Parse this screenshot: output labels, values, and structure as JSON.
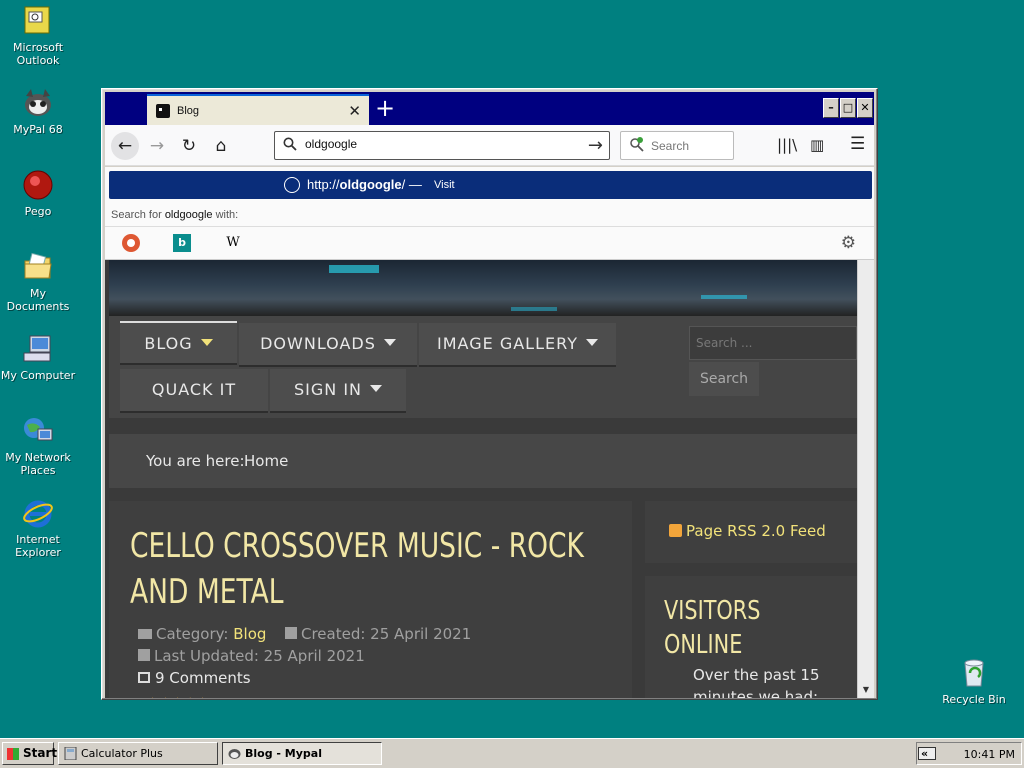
{
  "desktop": {
    "icons": [
      {
        "label_line1": "Microsoft",
        "label_line2": "Outlook",
        "icon": "outlook-icon"
      },
      {
        "label_line1": "MyPal 68",
        "label_line2": "",
        "icon": "mypal-icon"
      },
      {
        "label_line1": "Pego",
        "label_line2": "",
        "icon": "pego-icon"
      },
      {
        "label_line1": "My Documents",
        "label_line2": "",
        "icon": "folder-icon"
      },
      {
        "label_line1": "My Computer",
        "label_line2": "",
        "icon": "computer-icon"
      },
      {
        "label_line1": "My Network",
        "label_line2": "Places",
        "icon": "network-icon"
      },
      {
        "label_line1": "Internet",
        "label_line2": "Explorer",
        "icon": "ie-icon"
      },
      {
        "label_line1": "Recycle Bin",
        "label_line2": "",
        "icon": "recycle-bin-icon"
      }
    ]
  },
  "browser": {
    "tab_title": "Blog",
    "url_value": "oldgoogle",
    "search_placeholder": "Search",
    "suggestion_url_prefix": "http://",
    "suggestion_url_host": "oldgoogle",
    "suggestion_url_suffix": "/",
    "suggestion_dash": "—",
    "suggestion_action": "Visit",
    "search_for_prefix": "Search for",
    "search_for_term": "oldgoogle",
    "search_for_suffix": "with:",
    "engine_wiki": "W"
  },
  "page": {
    "menu": [
      {
        "label": "BLOG",
        "dropdown": true
      },
      {
        "label": "DOWNLOADS",
        "dropdown": true
      },
      {
        "label": "IMAGE GALLERY",
        "dropdown": true
      },
      {
        "label": "QUACK IT",
        "dropdown": false
      },
      {
        "label": "SIGN IN",
        "dropdown": true
      }
    ],
    "search_placeholder": "Search ...",
    "search_button": "Search",
    "breadcrumb_label": "You are here:",
    "breadcrumb_home": "Home",
    "article": {
      "title": "CELLO CROSSOVER MUSIC - ROCK AND METAL",
      "category_label": "Category:",
      "category_value": "Blog",
      "created": "Created: 25 April 2021",
      "updated": "Last Updated: 25 April 2021",
      "comments": "9 Comments",
      "stars": "★★★★★"
    },
    "rss_label": "Page RSS 2.0 Feed",
    "visitors_title_line1": "VISITORS",
    "visitors_title_line2": "ONLINE",
    "visitors_text": "Over the past 15 minutes we had:"
  },
  "taskbar": {
    "start_label": "Start",
    "tasks": [
      {
        "label": "Calculator Plus"
      },
      {
        "label": "Blog - Mypal"
      }
    ],
    "tray_chevron": "«",
    "clock": "10:41 PM"
  },
  "colors": {
    "desktop": "#008080",
    "titlebar": "#000080",
    "accent_yellow": "#f2e27a",
    "suggestion_bg": "#0a2d7a"
  }
}
